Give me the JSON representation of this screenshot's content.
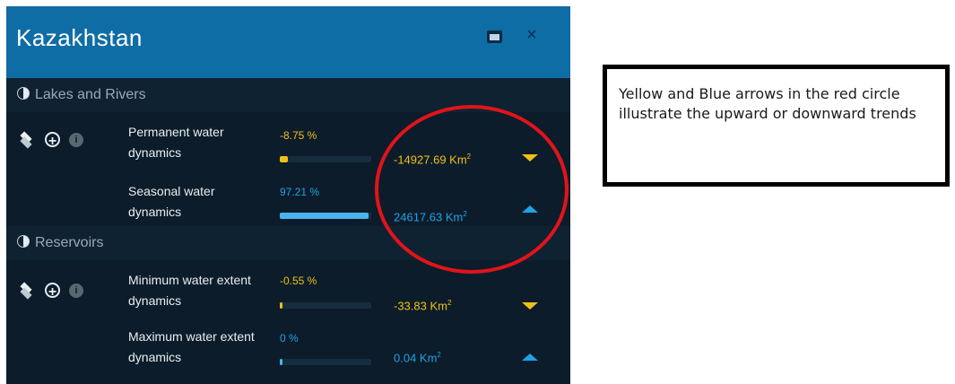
{
  "panel": {
    "title": "Kazakhstan",
    "window_icon": "window-icon",
    "close_icon": "close-icon",
    "close_glyph": "×"
  },
  "sections": [
    {
      "name": "Lakes and Rivers",
      "icon": "half-circle-icon",
      "tools": [
        "layers-icon",
        "add-circle-icon",
        "info-icon"
      ],
      "metrics": [
        {
          "label": "Permanent water dynamics",
          "percent": "-8.75 %",
          "percent_color": "#f0c018",
          "bar_fraction": 0.0875,
          "bar_color": "#f0c018",
          "km_value": "-14927.69 Km",
          "km_sup": "2",
          "km_color": "#f0c018",
          "trend": "down"
        },
        {
          "label": "Seasonal water dynamics",
          "percent": "97.21 %",
          "percent_color": "#1fa2e6",
          "bar_fraction": 0.9721,
          "bar_color": "#4cb3ee",
          "km_value": "24617.63 Km",
          "km_sup": "2",
          "km_color": "#1fa2e6",
          "trend": "up"
        }
      ]
    },
    {
      "name": "Reservoirs",
      "icon": "half-circle-icon",
      "tools": [
        "layers-icon",
        "add-circle-icon",
        "info-icon"
      ],
      "metrics": [
        {
          "label": "Minimum water extent dynamics",
          "percent": "-0.55 %",
          "percent_color": "#f0c018",
          "bar_fraction": 0.0055,
          "bar_color": "#f0c018",
          "km_value": "-33.83 Km",
          "km_sup": "2",
          "km_color": "#f0c018",
          "trend": "down"
        },
        {
          "label": "Maximum water extent dynamics",
          "percent": "0 %",
          "percent_color": "#1fa2e6",
          "bar_fraction": 0.0,
          "bar_color": "#4cb3ee",
          "km_value": "0.04 Km",
          "km_sup": "2",
          "km_color": "#1fa2e6",
          "trend": "up"
        }
      ]
    }
  ],
  "colors": {
    "header": "#0f6da6",
    "panel_bg": "#0c1c2a",
    "decrease": "#f0c018",
    "increase": "#1fa2e6",
    "annotation_circle": "#e0141a"
  },
  "annotation": {
    "text": "Yellow and Blue arrows in the red circle illustrate the upward or downward trends"
  }
}
